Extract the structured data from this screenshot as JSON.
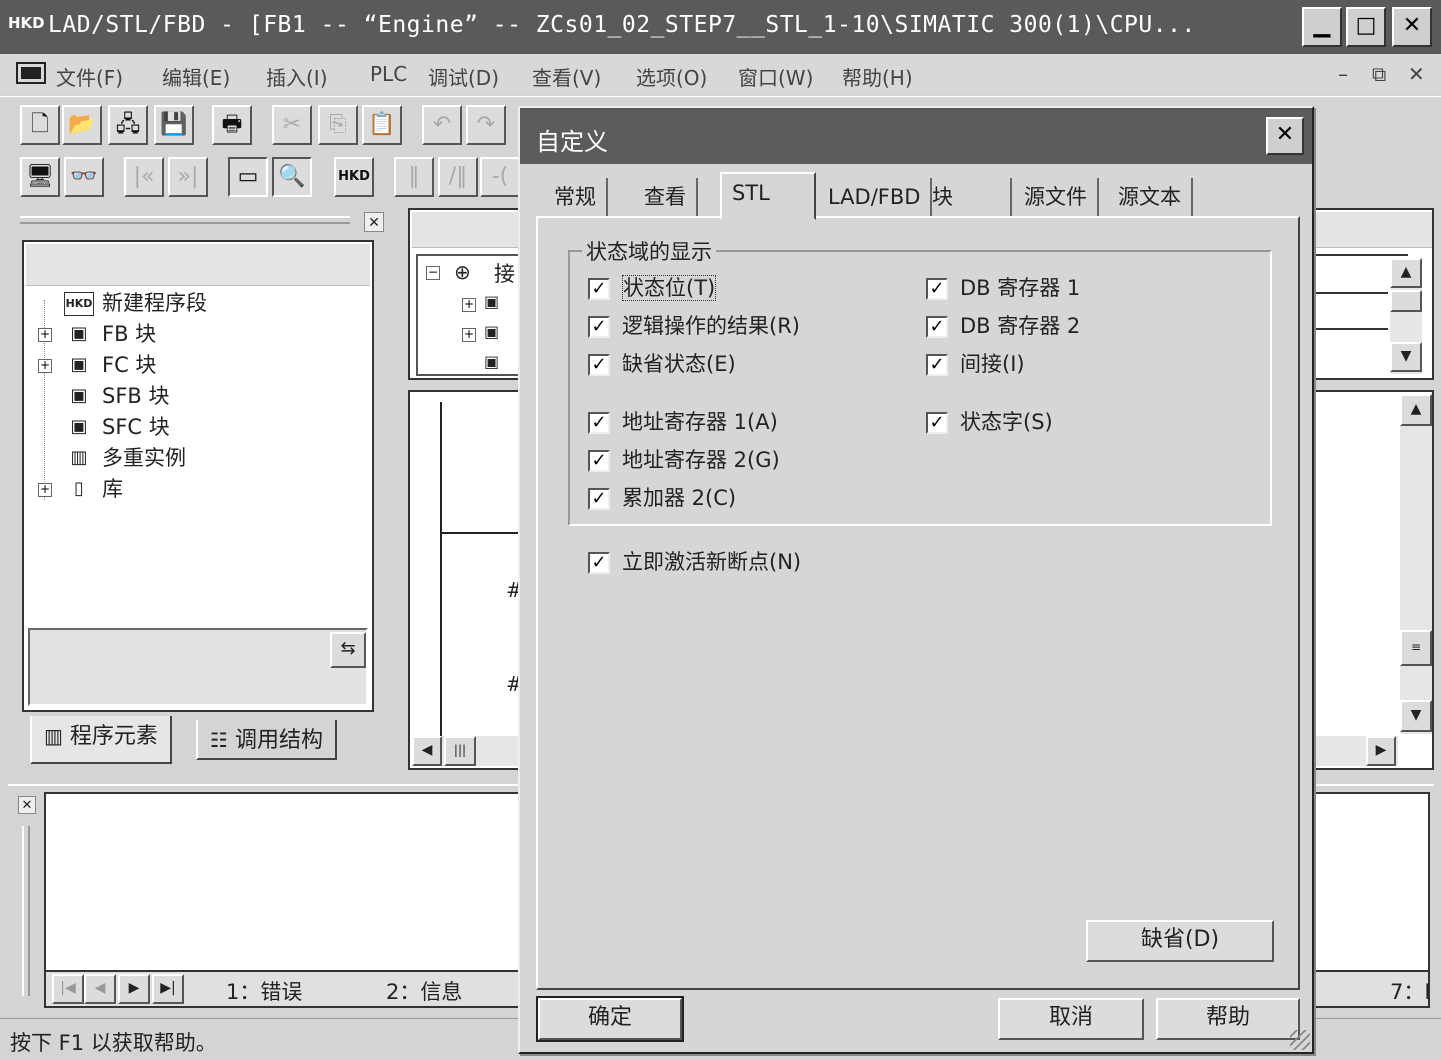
{
  "window": {
    "title": "LAD/STL/FBD  - [FB1 -- “Engine” -- ZCs01_02_STEP7__STL_1-10\\SIMATIC 300(1)\\CPU...",
    "logo_text": "HKD",
    "minimize_glyph": "▁",
    "maximize_glyph": "□",
    "close_glyph": "✕"
  },
  "menu": {
    "items": [
      "文件(F)",
      "编辑(E)",
      "插入(I)",
      "PLC",
      "调试(D)",
      "查看(V)",
      "选项(O)",
      "窗口(W)",
      "帮助(H)"
    ],
    "doc_min": "–",
    "doc_restore": "⧉",
    "doc_close": "✕"
  },
  "toolbar": {
    "row1": [
      "🗋",
      "📂",
      "🖧",
      "💾",
      "🖶",
      "✂",
      "⎘",
      "📋",
      "↶",
      "↷"
    ],
    "row2": [
      "🖥",
      "👓",
      "|«",
      "»|",
      "▭",
      "🔍",
      "HKD",
      "‖",
      "/‖",
      "-("
    ]
  },
  "left_panel": {
    "tree": [
      {
        "label": "新建程序段",
        "icon": "HKD"
      },
      {
        "label": "FB 块",
        "icon": "▣"
      },
      {
        "label": "FC 块",
        "icon": "▣"
      },
      {
        "label": "SFB 块",
        "icon": "▣"
      },
      {
        "label": "SFC 块",
        "icon": "▣"
      },
      {
        "label": "多重实例",
        "icon": "▥"
      },
      {
        "label": "库",
        "icon": "▯"
      }
    ],
    "tabs": [
      "程序元素",
      "调用结构"
    ],
    "panel_close": "✕"
  },
  "editor": {
    "tree_label": "接",
    "hash1": "#",
    "hash2": "#"
  },
  "output": {
    "tabs": [
      "1：错误",
      "2：信息",
      "7：I"
    ],
    "close": "✕"
  },
  "status": {
    "text": "按下 F1 以获取帮助。"
  },
  "dialog": {
    "title": "自定义",
    "close_glyph": "✕",
    "tabs": [
      "常规",
      "查看",
      "STL",
      "LAD/FBD",
      "块",
      "源文件",
      "源文本"
    ],
    "active_tab": "STL",
    "group_title": "状态域的显示",
    "left_options": [
      {
        "label": "状态位(T)",
        "checked": true
      },
      {
        "label": "逻辑操作的结果(R)",
        "checked": true
      },
      {
        "label": "缺省状态(E)",
        "checked": true
      },
      {
        "label": "地址寄存器 1(A)",
        "checked": true
      },
      {
        "label": "地址寄存器 2(G)",
        "checked": true
      },
      {
        "label": "累加器 2(C)",
        "checked": true
      }
    ],
    "right_options": [
      {
        "label": "DB 寄存器 1",
        "checked": true
      },
      {
        "label": "DB 寄存器 2",
        "checked": true
      },
      {
        "label": "间接(I)",
        "checked": true
      },
      {
        "label": "状态字(S)",
        "checked": true
      }
    ],
    "activate_breakpoint": {
      "label": "立即激活新断点(N)",
      "checked": true
    },
    "check_mark": "✓",
    "default_button": "缺省(D)",
    "ok_button": "确定",
    "cancel_button": "取消",
    "help_button": "帮助"
  }
}
